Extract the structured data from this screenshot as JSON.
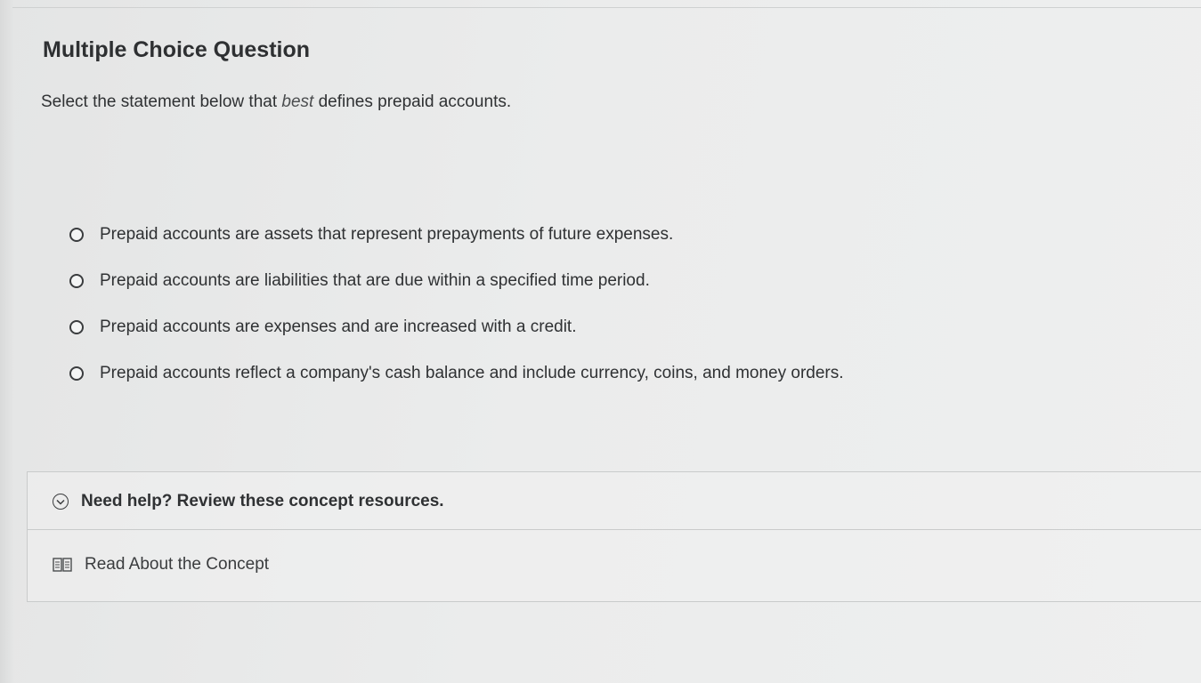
{
  "question": {
    "title": "Multiple Choice Question",
    "prompt_before": "Select the statement below that ",
    "prompt_emphasis": "best",
    "prompt_after": " defines prepaid accounts."
  },
  "choices": [
    {
      "label": "Prepaid accounts are assets that represent prepayments of future expenses."
    },
    {
      "label": "Prepaid accounts are liabilities that are due within a specified time period."
    },
    {
      "label": "Prepaid accounts are expenses and are increased with a credit."
    },
    {
      "label": "Prepaid accounts reflect a company's cash balance and include currency, coins, and money orders."
    }
  ],
  "help": {
    "header": "Need help? Review these concept resources.",
    "resource_label": "Read About the Concept",
    "header_icon": "chevron-down-circle-icon",
    "resource_icon": "book-icon"
  }
}
